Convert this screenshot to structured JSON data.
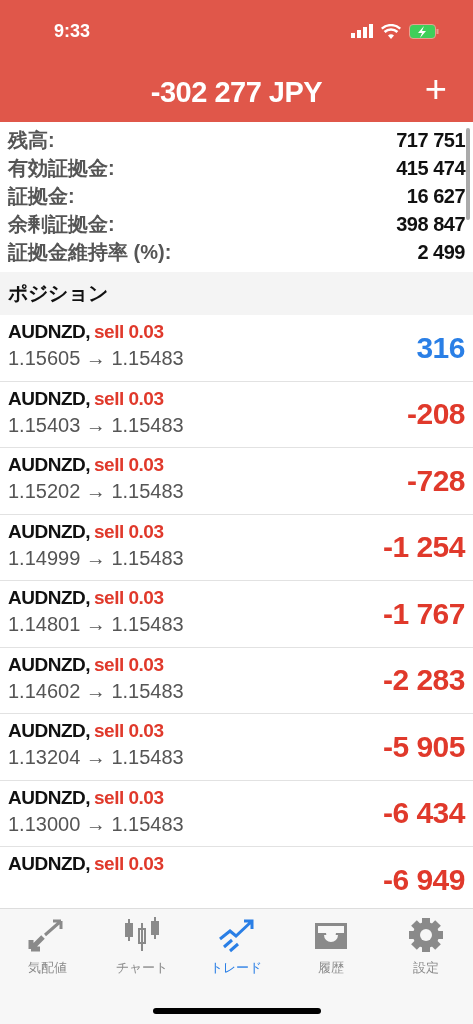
{
  "status_bar": {
    "time": "9:33"
  },
  "header": {
    "title": "-302 277 JPY",
    "add_button": "+"
  },
  "account": [
    {
      "label": "残高:",
      "value": "717 751"
    },
    {
      "label": "有効証拠金:",
      "value": "415 474"
    },
    {
      "label": "証拠金:",
      "value": "16 627"
    },
    {
      "label": "余剰証拠金:",
      "value": "398 847"
    },
    {
      "label": "証拠金維持率 (%):",
      "value": "2 499"
    }
  ],
  "section_title": "ポジション",
  "positions": [
    {
      "symbol": "AUDNZD,",
      "order": "sell 0.03",
      "prices": "1.15605 → 1.15483",
      "profit": "316",
      "color": "#2a7fe6"
    },
    {
      "symbol": "AUDNZD,",
      "order": "sell 0.03",
      "prices": "1.15403 → 1.15483",
      "profit": "-208",
      "color": "#e0392b"
    },
    {
      "symbol": "AUDNZD,",
      "order": "sell 0.03",
      "prices": "1.15202 → 1.15483",
      "profit": "-728",
      "color": "#e0392b"
    },
    {
      "symbol": "AUDNZD,",
      "order": "sell 0.03",
      "prices": "1.14999 → 1.15483",
      "profit": "-1 254",
      "color": "#e0392b"
    },
    {
      "symbol": "AUDNZD,",
      "order": "sell 0.03",
      "prices": "1.14801 → 1.15483",
      "profit": "-1 767",
      "color": "#e0392b"
    },
    {
      "symbol": "AUDNZD,",
      "order": "sell 0.03",
      "prices": "1.14602 → 1.15483",
      "profit": "-2 283",
      "color": "#e0392b"
    },
    {
      "symbol": "AUDNZD,",
      "order": "sell 0.03",
      "prices": "1.13204 → 1.15483",
      "profit": "-5 905",
      "color": "#e0392b"
    },
    {
      "symbol": "AUDNZD,",
      "order": "sell 0.03",
      "prices": "1.13000 → 1.15483",
      "profit": "-6 434",
      "color": "#e0392b"
    },
    {
      "symbol": "AUDNZD,",
      "order": "sell 0.03",
      "profit": "-6 949",
      "color": "#e0392b"
    }
  ],
  "tabs": [
    {
      "label": "気配値",
      "selected": false
    },
    {
      "label": "チャート",
      "selected": false
    },
    {
      "label": "トレード",
      "selected": true
    },
    {
      "label": "履歴",
      "selected": false
    },
    {
      "label": "設定",
      "selected": false
    }
  ]
}
